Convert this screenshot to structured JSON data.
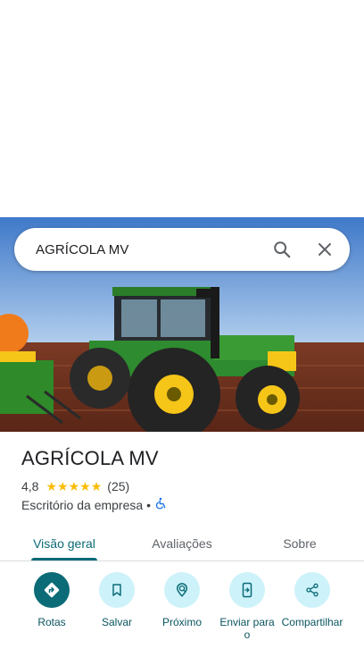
{
  "search": {
    "query": "AGRÍCOLA MV",
    "search_icon": "search-icon",
    "close_icon": "close-icon"
  },
  "photo": {
    "subject": "tractor-photo"
  },
  "place": {
    "title": "AGRÍCOLA MV",
    "rating": "4,8",
    "stars": 4.8,
    "review_count": "(25)",
    "category": "Escritório da empresa",
    "separator": "•",
    "accessibility_icon": "wheelchair-icon"
  },
  "tabs": [
    {
      "label": "Visão geral",
      "active": true
    },
    {
      "label": "Avaliações",
      "active": false
    },
    {
      "label": "Sobre",
      "active": false
    }
  ],
  "actions": [
    {
      "label": "Rotas",
      "icon": "directions-icon"
    },
    {
      "label": "Salvar",
      "icon": "bookmark-icon"
    },
    {
      "label": "Próximo",
      "icon": "nearby-icon"
    },
    {
      "label": "Enviar para o",
      "icon": "send-to-phone-icon"
    },
    {
      "label": "Compartilhar",
      "icon": "share-icon"
    }
  ],
  "colors": {
    "accent": "#0b6b76",
    "action_bg": "#cdf2fa",
    "star": "#fbbc04"
  }
}
